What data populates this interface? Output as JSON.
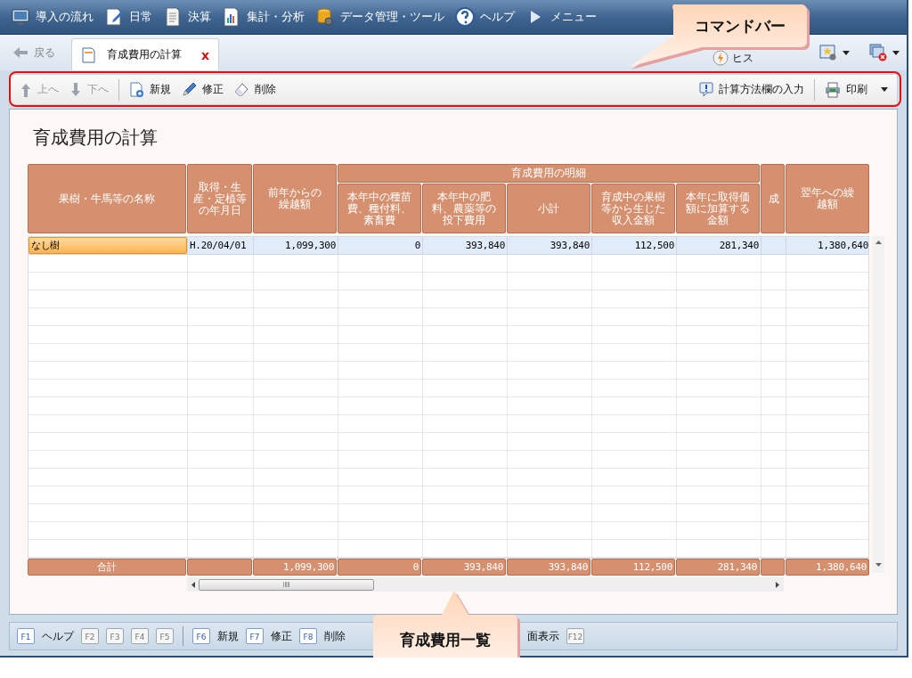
{
  "nav_menu": [
    {
      "label": "導入の流れ"
    },
    {
      "label": "日常"
    },
    {
      "label": "決算"
    },
    {
      "label": "集計・分析"
    },
    {
      "label": "データ管理・ツール"
    },
    {
      "label": "ヘルプ"
    },
    {
      "label": "メニュー"
    }
  ],
  "back_button": {
    "label": "戻る",
    "disabled": true
  },
  "tabs": [
    {
      "label": "育成費用の計算",
      "selected": true,
      "close": "x"
    }
  ],
  "history_button": {
    "label": "ヒス"
  },
  "toolbar": {
    "left": [
      {
        "label": "上へ",
        "disabled": true
      },
      {
        "label": "下へ",
        "disabled": true
      },
      {
        "label": "新規",
        "disabled": false
      },
      {
        "label": "修正",
        "disabled": false
      },
      {
        "label": "削除",
        "disabled": false
      }
    ],
    "right": [
      {
        "label": "計算方法欄の入力"
      },
      {
        "label": "印刷"
      }
    ]
  },
  "page_title": "育成費用の計算",
  "table": {
    "group_header": "育成費用の明細",
    "columns": [
      {
        "label": "果樹・牛馬等の名称"
      },
      {
        "label": "取得・生産・定植等の年月日"
      },
      {
        "label": "前年からの繰越額"
      },
      {
        "label": "本年中の種苗費、種付料、素畜費"
      },
      {
        "label": "本年中の肥料、農薬等の投下費用"
      },
      {
        "label": "小計"
      },
      {
        "label": "育成中の果樹等から生じた収入金額"
      },
      {
        "label": "本年に取得価額に加算する金額"
      },
      {
        "label": "成"
      },
      {
        "label": "翌年への繰越額"
      }
    ],
    "rows": [
      {
        "selected": true,
        "cells": [
          {
            "text": "なし樹"
          },
          {
            "text": "H.20/04/01"
          },
          {
            "text": "1,099,300"
          },
          {
            "text": "0"
          },
          {
            "text": "393,840"
          },
          {
            "text": "393,840"
          },
          {
            "text": "112,500"
          },
          {
            "text": "281,340"
          },
          {},
          {
            "text": "1,380,640"
          }
        ]
      }
    ],
    "totals": {
      "label": "合計",
      "amounts": [
        "1,099,300",
        "0",
        "393,840",
        "393,840",
        "112,500",
        "281,340",
        "1,380,640"
      ]
    }
  },
  "function_keys": [
    {
      "key": "F1",
      "label": "ヘルプ",
      "disabled": false
    },
    {
      "key": "F2",
      "disabled": true
    },
    {
      "key": "F3",
      "disabled": true
    },
    {
      "key": "F4",
      "disabled": true
    },
    {
      "key": "F5",
      "disabled": true
    },
    {
      "key": "F6",
      "label": "新規",
      "disabled": false
    },
    {
      "key": "F7",
      "label": "修正",
      "disabled": false
    },
    {
      "key": "F8",
      "label": "削除",
      "disabled": false
    },
    {
      "label": "面表示"
    },
    {
      "key": "F12",
      "disabled": true
    }
  ],
  "callouts": [
    {
      "text": "コマンドバー"
    },
    {
      "text": "育成費用一覧"
    }
  ]
}
